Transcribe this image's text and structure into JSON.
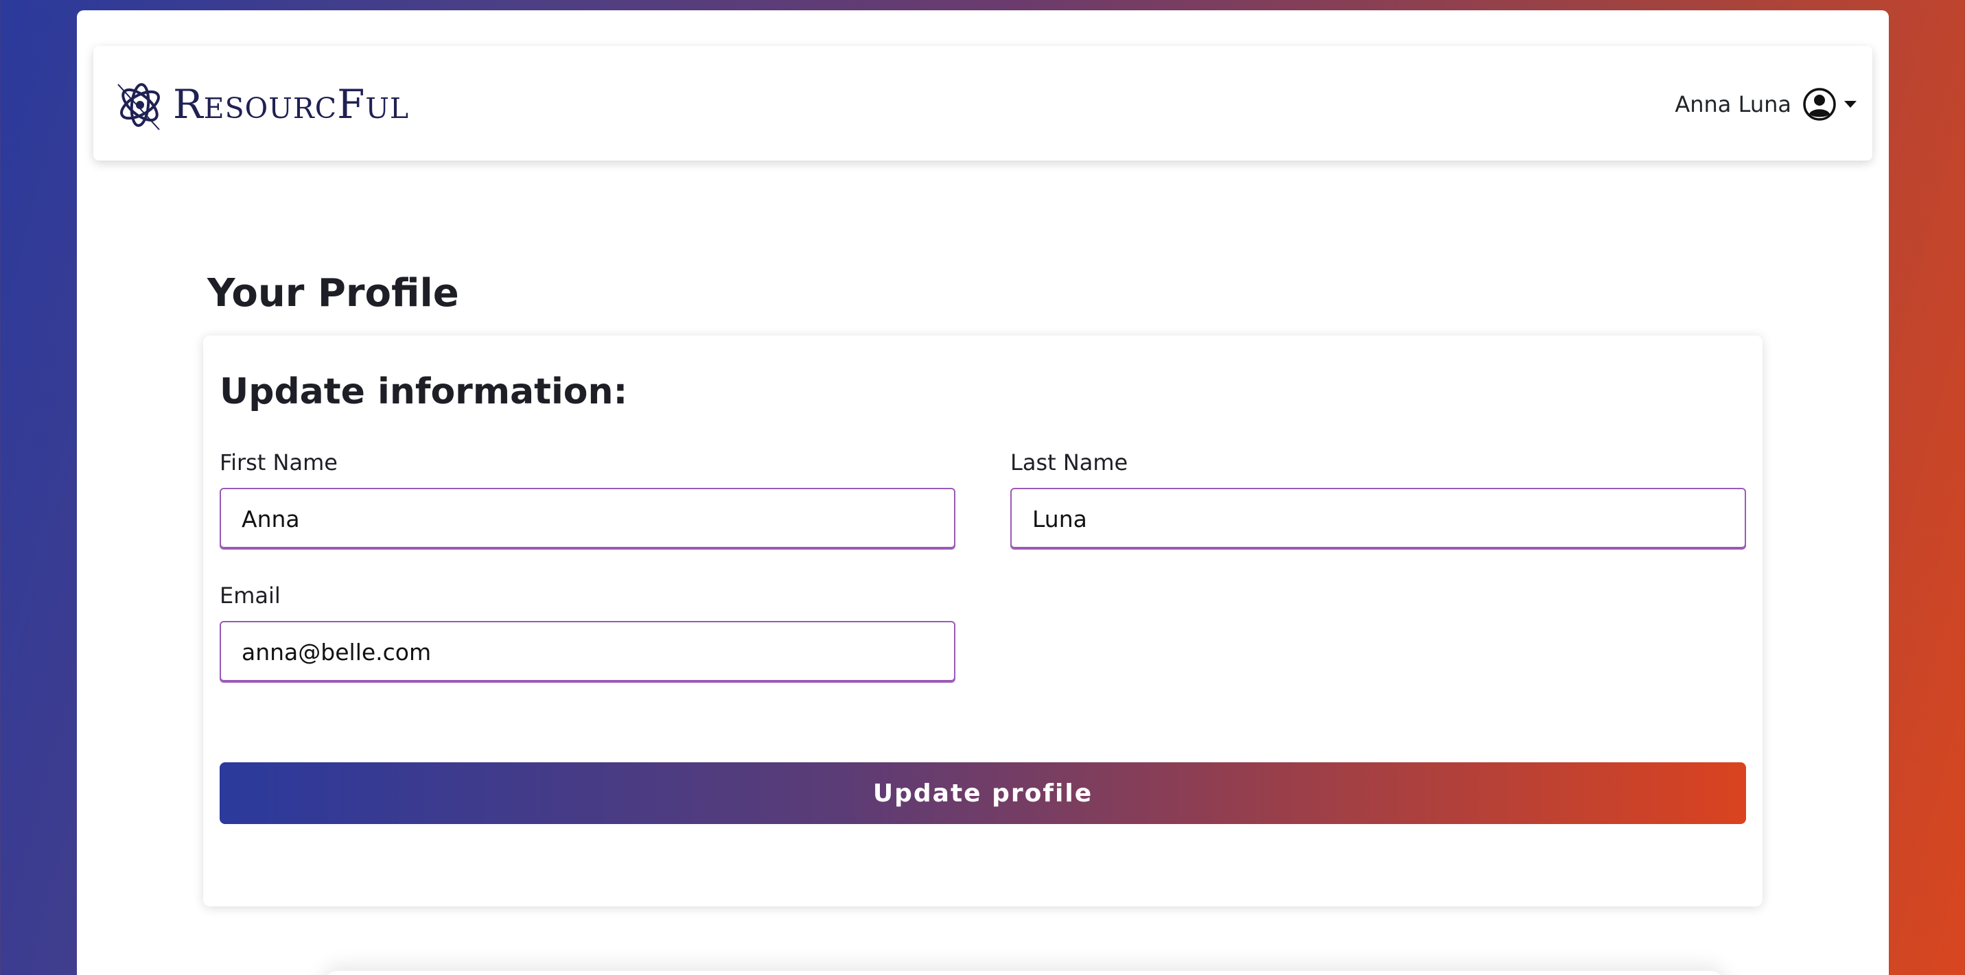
{
  "navbar": {
    "brand_name": "ResourcFul",
    "brand_logo_icon": "atom-orbit-logo-icon",
    "user_name": "Anna Luna",
    "user_icon": "user-circle-icon",
    "dropdown_icon": "caret-down-icon"
  },
  "page": {
    "title": "Your Profile"
  },
  "profile_form": {
    "heading": "Update information:",
    "first_name": {
      "label": "First Name",
      "value": "Anna"
    },
    "last_name": {
      "label": "Last Name",
      "value": "Luna"
    },
    "email": {
      "label": "Email",
      "value": "anna@belle.com"
    },
    "submit_label": "Update profile"
  },
  "colors": {
    "brand_navy": "#1f2154",
    "input_border": "#9b59b6",
    "gradient_start": "#2b3a9c",
    "gradient_end": "#da431f"
  }
}
